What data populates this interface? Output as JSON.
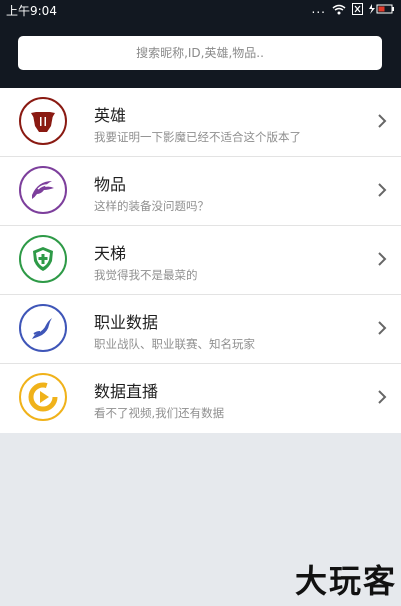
{
  "status": {
    "time": "上午9:04",
    "dots": "..."
  },
  "search": {
    "placeholder": "搜索昵称,ID,英雄,物品.."
  },
  "menu": [
    {
      "title": "英雄",
      "subtitle": "我要证明一下影魔已经不适合这个版本了",
      "icon": "hero-icon",
      "color": "#8a1a12"
    },
    {
      "title": "物品",
      "subtitle": "这样的装备没问题吗？",
      "icon": "item-icon",
      "color": "#7d3f9c"
    },
    {
      "title": "天梯",
      "subtitle": "我觉得我不是最菜的",
      "icon": "ladder-icon",
      "color": "#2e9a47"
    },
    {
      "title": "职业数据",
      "subtitle": "职业战队、职业联赛、知名玩家",
      "icon": "pro-data-icon",
      "color": "#3f56b8"
    },
    {
      "title": "数据直播",
      "subtitle": "看不了视频,我们还有数据",
      "icon": "live-data-icon",
      "color": "#f0b21a"
    }
  ],
  "watermark": "大玩客"
}
